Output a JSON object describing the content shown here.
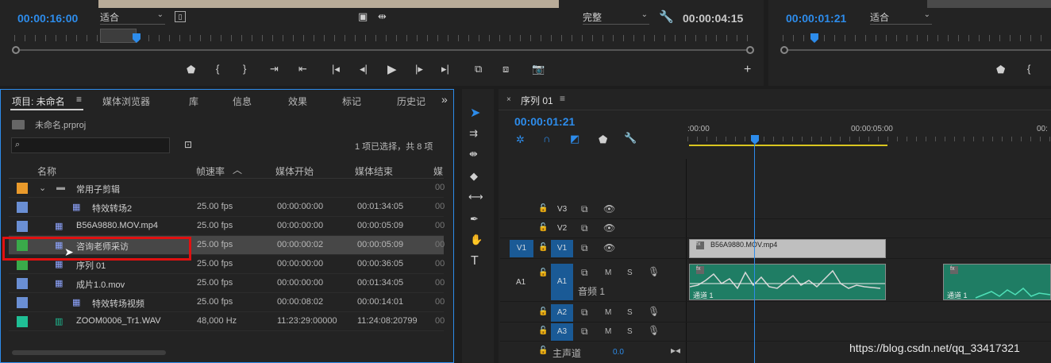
{
  "source_monitor": {
    "timecode": "00:00:16:00",
    "fit": "适合",
    "quality": "完整",
    "duration": "00:00:04:15"
  },
  "program_monitor": {
    "timecode": "00:00:01:21",
    "fit": "适合"
  },
  "project_panel": {
    "tabs": [
      "项目: 未命名",
      "媒体浏览器",
      "库",
      "信息",
      "效果",
      "标记",
      "历史记"
    ],
    "project_file": "未命名.prproj",
    "selection_status": "1 项已选择，共 8 项",
    "columns": [
      "名称",
      "帧速率",
      "媒体开始",
      "媒体结束",
      "媒"
    ],
    "items": [
      {
        "color": "#e99a2b",
        "name": "常用子剪辑",
        "fps": "",
        "start": "",
        "end": "",
        "type": "folder"
      },
      {
        "color": "#6a8fd4",
        "name": "特效转场2",
        "fps": "25.00 fps",
        "start": "00:00:00:00",
        "end": "00:01:34:05",
        "type": "sequence"
      },
      {
        "color": "#6a8fd4",
        "name": "B56A9880.MOV.mp4",
        "fps": "25.00 fps",
        "start": "00:00:00:00",
        "end": "00:00:05:09",
        "type": "clip"
      },
      {
        "color": "#3aaa4a",
        "name": "咨询老师采访",
        "fps": "25.00 fps",
        "start": "00:00:00:02",
        "end": "00:00:05:09",
        "type": "clip"
      },
      {
        "color": "#3aaa4a",
        "name": "序列 01",
        "fps": "25.00 fps",
        "start": "00:00:00:00",
        "end": "00:00:36:05",
        "type": "sequence"
      },
      {
        "color": "#6a8fd4",
        "name": "成片1.0.mov",
        "fps": "25.00 fps",
        "start": "00:00:00:00",
        "end": "00:01:34:05",
        "type": "clip"
      },
      {
        "color": "#6a8fd4",
        "name": "特效转场视频",
        "fps": "25.00 fps",
        "start": "00:00:08:02",
        "end": "00:00:14:01",
        "type": "sequence"
      },
      {
        "color": "#1fbf95",
        "name": "ZOOM0006_Tr1.WAV",
        "fps": "48,000 Hz",
        "start": "11:23:29:00000",
        "end": "11:24:08:20799",
        "type": "audio"
      }
    ]
  },
  "timeline": {
    "tab": "序列 01",
    "timecode": "00:00:01:21",
    "ruler": [
      ":00:00",
      "00:00:05:00",
      "00:"
    ],
    "tracks_video": [
      {
        "target": "",
        "name": "V3"
      },
      {
        "target": "",
        "name": "V2"
      },
      {
        "target": "V1",
        "name": "V1"
      }
    ],
    "tracks_audio": [
      {
        "target": "A1",
        "name": "A1",
        "label": "音频 1"
      },
      {
        "target": "",
        "name": "A2"
      },
      {
        "target": "",
        "name": "A3"
      }
    ],
    "master": {
      "label": "主声道",
      "value": "0.0"
    },
    "mute": "M",
    "solo": "S",
    "clips": {
      "video": "B56A9880.MOV.mp4",
      "audio_1": "通道 1",
      "audio_2": "通道 1"
    }
  },
  "watermark": "https://blog.csdn.net/qq_33417321"
}
